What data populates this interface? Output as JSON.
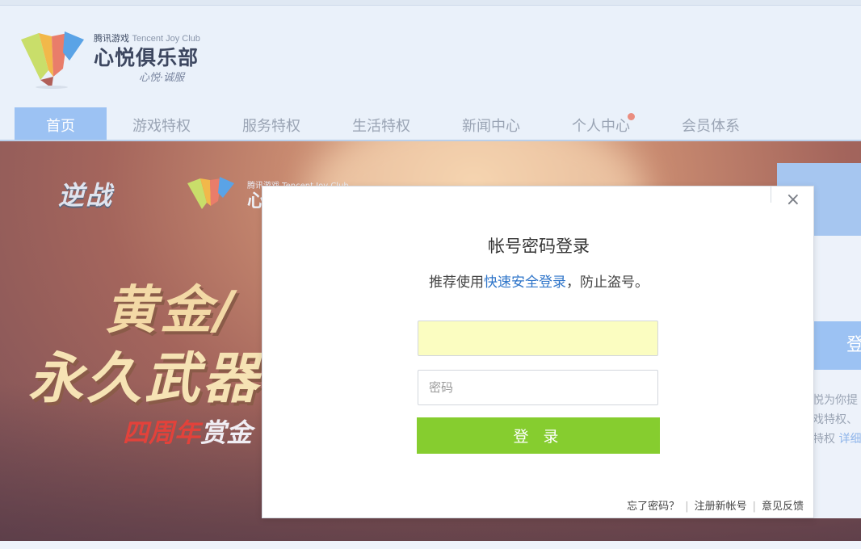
{
  "brand": {
    "small_cn": "腾讯游戏",
    "small_en": "Tencent Joy Club",
    "name": "心悦俱乐部",
    "slogan": "心悦·诚服"
  },
  "nav": {
    "items": [
      {
        "label": "首页",
        "active": true
      },
      {
        "label": "游戏特权"
      },
      {
        "label": "服务特权"
      },
      {
        "label": "生活特权"
      },
      {
        "label": "新闻中心"
      },
      {
        "label": "个人中心",
        "notification_dot": true
      },
      {
        "label": "会员体系"
      }
    ]
  },
  "banner": {
    "game_logo": "逆战",
    "club_small": "腾讯游戏 Tencent Joy Club",
    "club_big": "心",
    "line1": "黄金/",
    "line2": "永久武器",
    "line3_red": "四周年",
    "line3_white": "赏金"
  },
  "side_panel": {
    "login_label": "登",
    "desc_lines": [
      "悦为你提",
      "戏特权、",
      "特权"
    ],
    "link": "详细"
  },
  "login_modal": {
    "close_symbol": "×",
    "title": "帐号密码登录",
    "subtitle_prefix": "推荐使用",
    "subtitle_link": "快速安全登录",
    "subtitle_suffix": "，防止盗号。",
    "account_value": "",
    "password_placeholder": "密码",
    "submit_label": "登 录",
    "footer": {
      "forgot": "忘了密码？",
      "register": "注册新帐号",
      "feedback": "意见反馈",
      "separator": "|"
    }
  },
  "colors": {
    "nav_active": "#9cc2f3",
    "submit_green": "#86cd2f",
    "link_blue": "#2f75c9",
    "notification": "#ea8d7f"
  }
}
